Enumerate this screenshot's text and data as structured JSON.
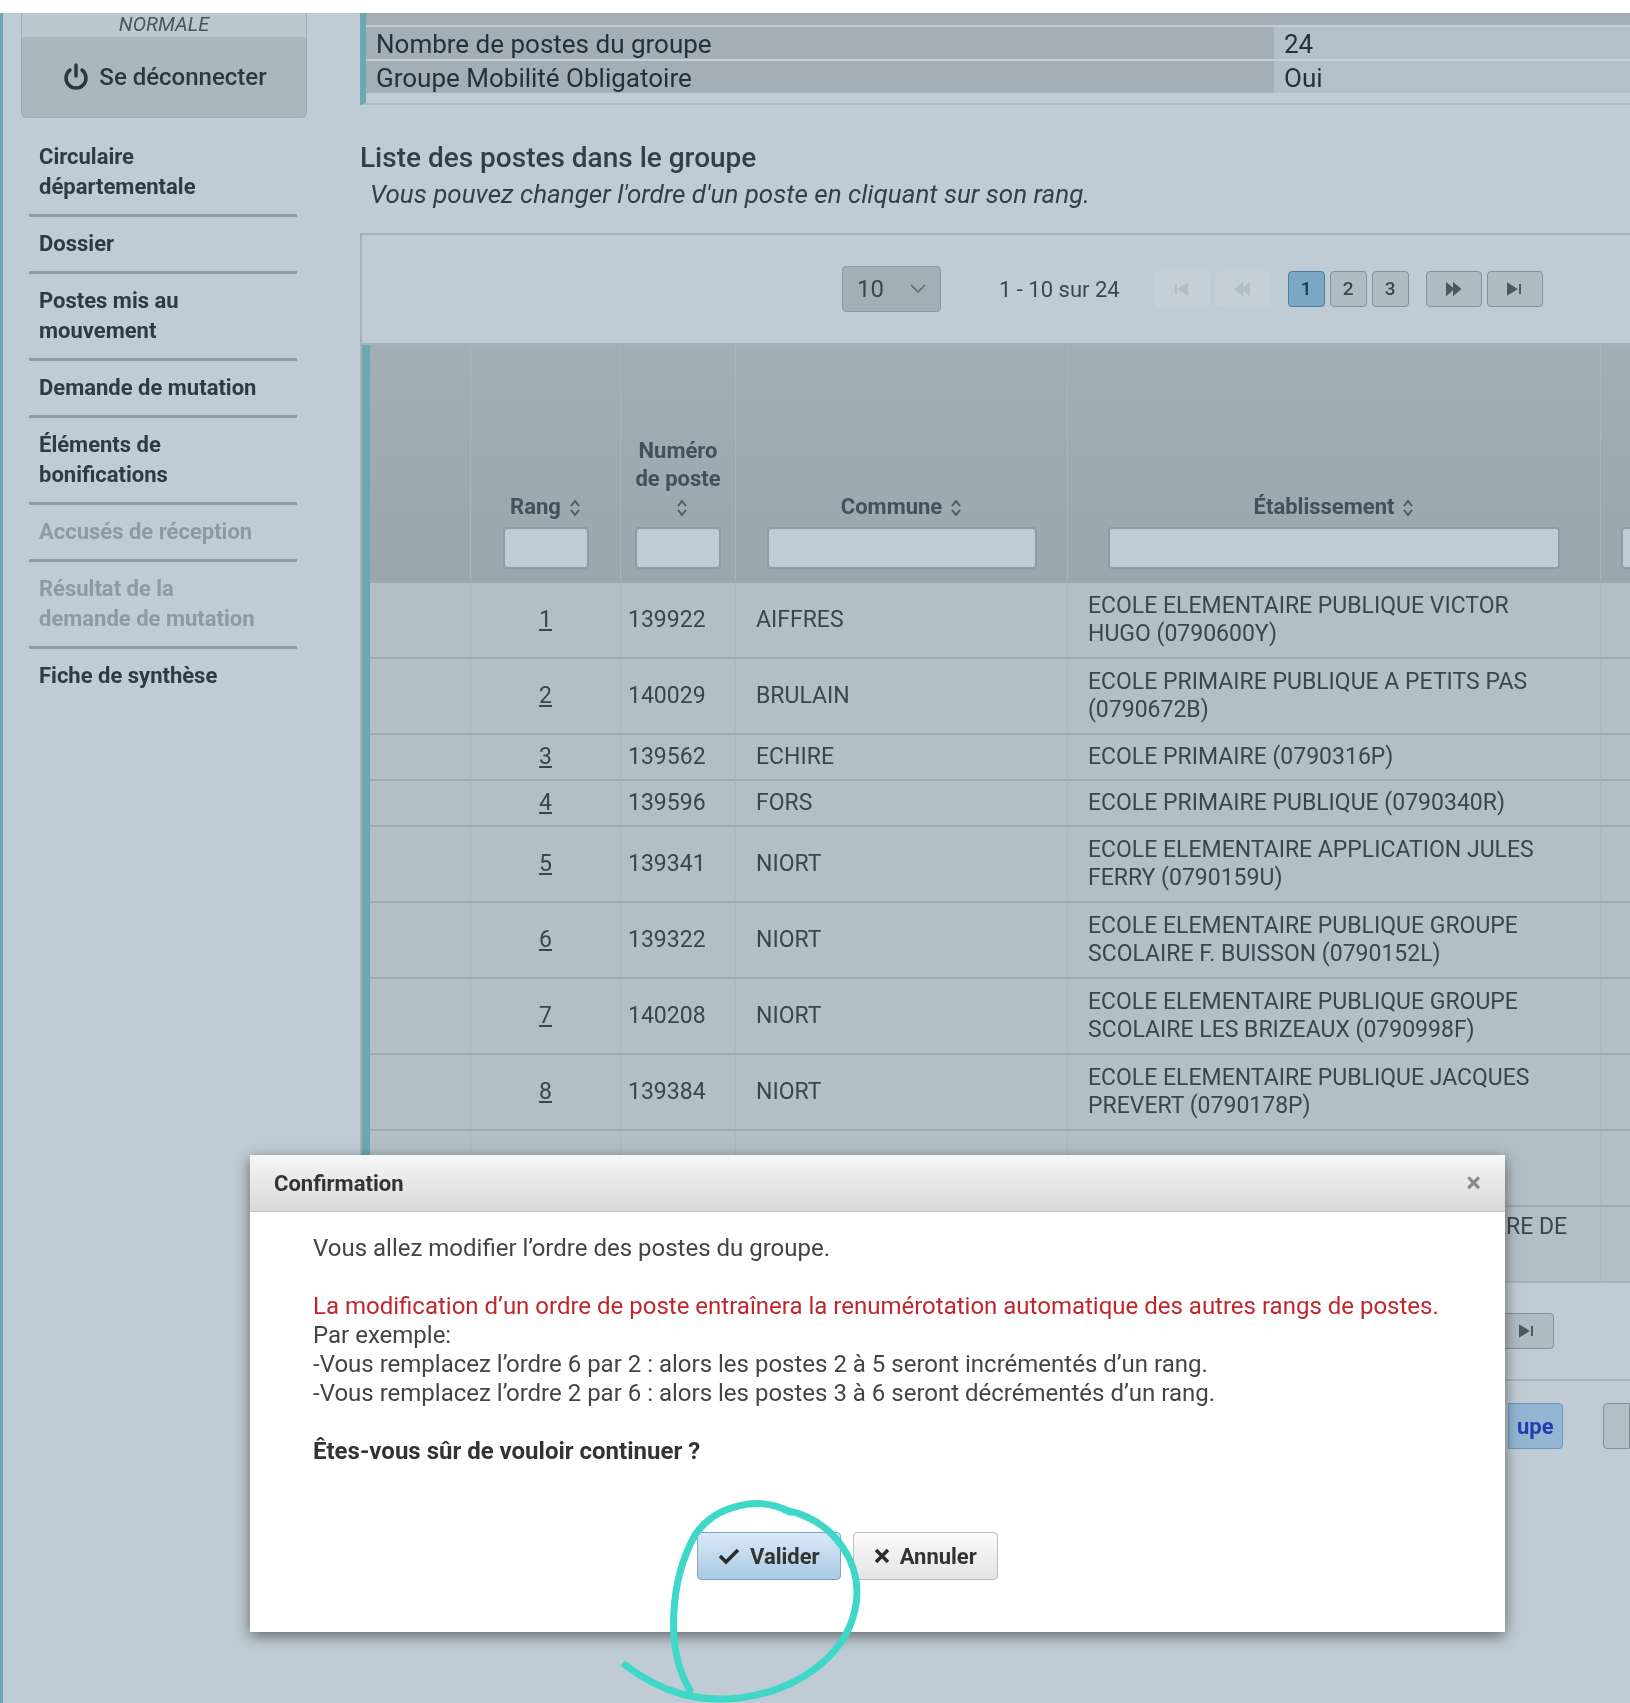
{
  "sidebar": {
    "status": "NORMALE",
    "logout": "Se déconnecter",
    "items": [
      {
        "label": "Circulaire départementale",
        "disabled": false
      },
      {
        "label": "Dossier",
        "disabled": false
      },
      {
        "label": "Postes mis au mouvement",
        "disabled": false
      },
      {
        "label": "Demande de mutation",
        "disabled": false
      },
      {
        "label": "Éléments de bonifications",
        "disabled": false
      },
      {
        "label": "Accusés de réception",
        "disabled": true
      },
      {
        "label": "Résultat de la demande de mutation",
        "disabled": true
      },
      {
        "label": "Fiche de synthèse",
        "disabled": false
      }
    ]
  },
  "info_rows": [
    {
      "label": "Nombre de postes du groupe",
      "value": "24"
    },
    {
      "label": "Groupe Mobilité Obligatoire",
      "value": "Oui"
    }
  ],
  "list": {
    "title": "Liste des postes dans le groupe",
    "subtitle": "Vous pouvez changer l'ordre d'un poste en cliquant sur son rang."
  },
  "pager": {
    "page_size": "10",
    "range": "1 - 10 sur 24",
    "first_disabled": true,
    "prev_disabled": true,
    "pages": [
      {
        "label": "1",
        "selected": true
      },
      {
        "label": "2",
        "selected": false
      },
      {
        "label": "3",
        "selected": false
      }
    ]
  },
  "table": {
    "columns": [
      "Rang",
      "Numéro de poste",
      "Commune",
      "Établissement"
    ],
    "rows": [
      {
        "rank": "1",
        "number": "139922",
        "commune": "AIFFRES",
        "establishment": "ECOLE ELEMENTAIRE PUBLIQUE VICTOR HUGO (0790600Y)"
      },
      {
        "rank": "2",
        "number": "140029",
        "commune": "BRULAIN",
        "establishment": "ECOLE PRIMAIRE PUBLIQUE A PETITS PAS (0790672B)"
      },
      {
        "rank": "3",
        "number": "139562",
        "commune": "ECHIRE",
        "establishment": "ECOLE PRIMAIRE (0790316P)"
      },
      {
        "rank": "4",
        "number": "139596",
        "commune": "FORS",
        "establishment": "ECOLE PRIMAIRE PUBLIQUE (0790340R)"
      },
      {
        "rank": "5",
        "number": "139341",
        "commune": "NIORT",
        "establishment": "ECOLE ELEMENTAIRE APPLICATION JULES FERRY (0790159U)"
      },
      {
        "rank": "6",
        "number": "139322",
        "commune": "NIORT",
        "establishment": "ECOLE ELEMENTAIRE PUBLIQUE GROUPE SCOLAIRE F. BUISSON (0790152L)"
      },
      {
        "rank": "7",
        "number": "140208",
        "commune": "NIORT",
        "establishment": "ECOLE ELEMENTAIRE PUBLIQUE GROUPE SCOLAIRE LES BRIZEAUX (0790998F)"
      },
      {
        "rank": "8",
        "number": "139384",
        "commune": "NIORT",
        "establishment": "ECOLE ELEMENTAIRE PUBLIQUE JACQUES PREVERT (0790178P)"
      }
    ],
    "covered_rows": [
      "RE DE"
    ]
  },
  "bottom_button": "upe",
  "dialog": {
    "title": "Confirmation",
    "close": "×",
    "intro": "Vous allez modifier l’ordre des postes du groupe.",
    "warning": "La modification d’un ordre de poste entraînera la renumérotation automatique des autres rangs de postes.",
    "example_lines": [
      "Par exemple:",
      "-Vous remplacez l’ordre 6 par 2 : alors les postes 2 à 5 seront incrémentés d’un rang.",
      "-Vous remplacez l’ordre 2 par 6 : alors les postes 3 à 6 seront décrémentés d’un rang."
    ],
    "question": "Êtes-vous sûr de vouloir continuer ?",
    "buttons": [
      {
        "kind": "confirm",
        "label": "Valider"
      },
      {
        "kind": "cancel",
        "label": "Annuler"
      }
    ]
  }
}
